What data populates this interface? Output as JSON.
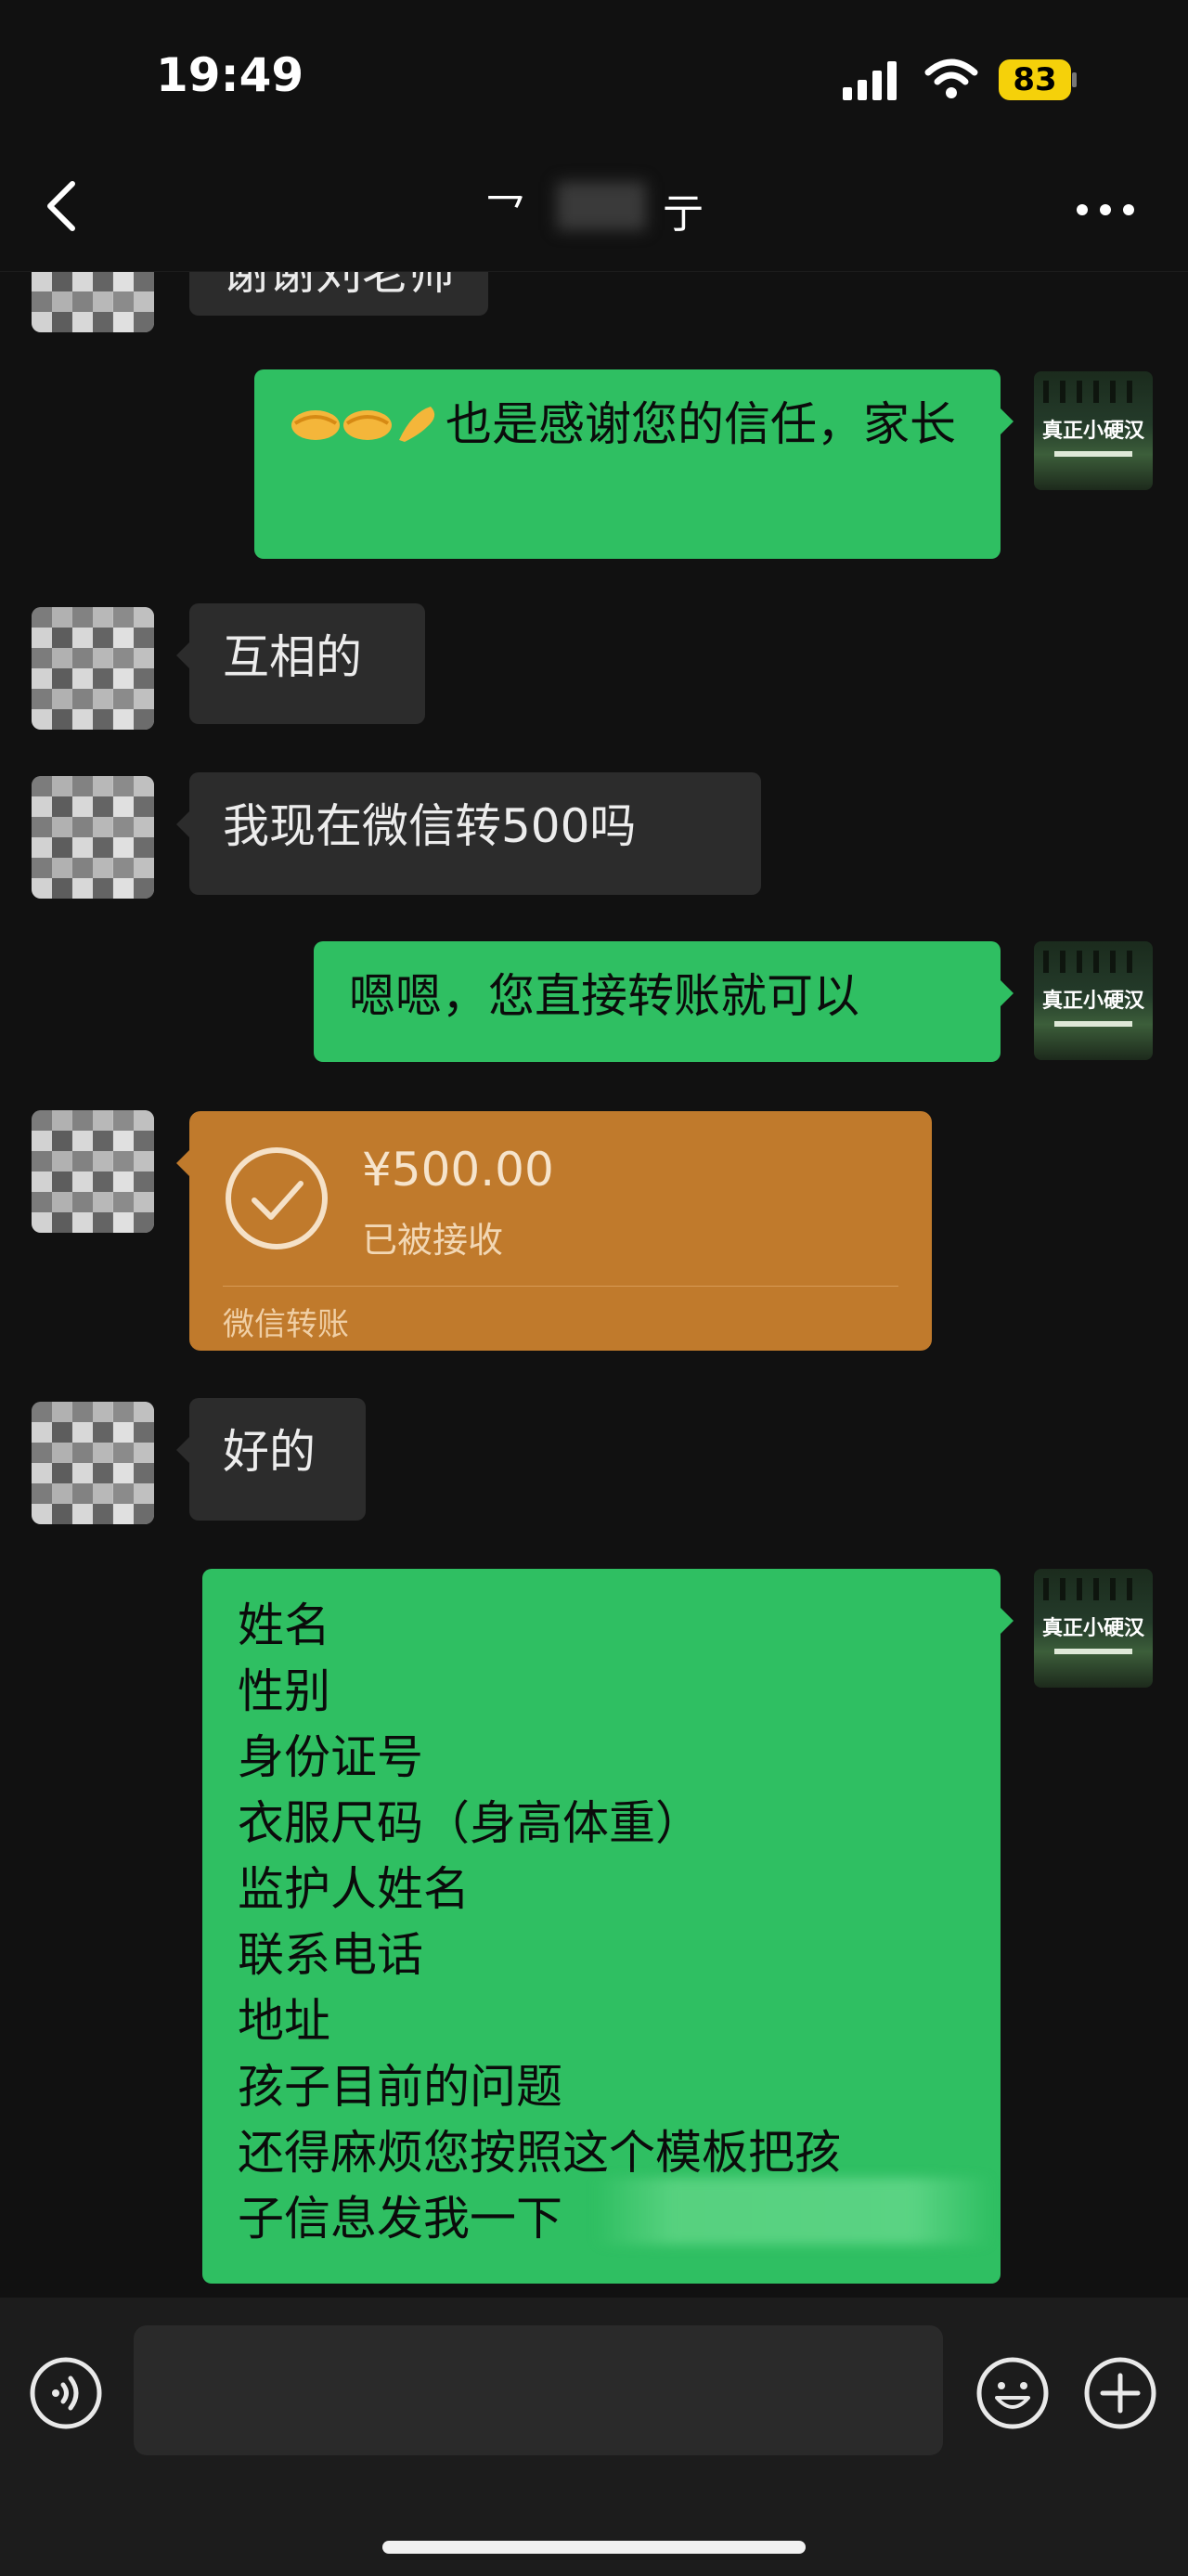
{
  "status_bar": {
    "time": "19:49",
    "battery": "83"
  },
  "nav": {
    "title_left": "乛",
    "title_right": "亍"
  },
  "messages": {
    "m0_text": "谢谢刘老师",
    "m1_text": "也是感谢您的信任，家长",
    "m2_text": "互相的",
    "m3_text": "我现在微信转500吗",
    "m4_text": "嗯嗯，您直接转账就可以",
    "m5": {
      "amount": "¥500.00",
      "status": "已被接收",
      "label": "微信转账"
    },
    "m6_text": "好的",
    "m7_lines": [
      "姓名",
      "性别",
      "身份证号",
      "衣服尺码（身高体重）",
      "监护人姓名",
      "联系电话",
      "地址",
      "孩子目前的问题",
      "还得麻烦您按照这个模板把孩",
      "子信息发我一下"
    ]
  },
  "self_avatar": {
    "text": "真正小硬汉"
  },
  "colors": {
    "self_bubble": "#2fbf62",
    "other_bubble": "#2c2c2c",
    "transfer_card": "#c07a2c",
    "background": "#111111"
  },
  "icons": [
    "back-icon",
    "more-icon",
    "signal-icon",
    "wifi-icon",
    "check-icon",
    "voice-icon",
    "emoji-icon",
    "plus-icon"
  ]
}
